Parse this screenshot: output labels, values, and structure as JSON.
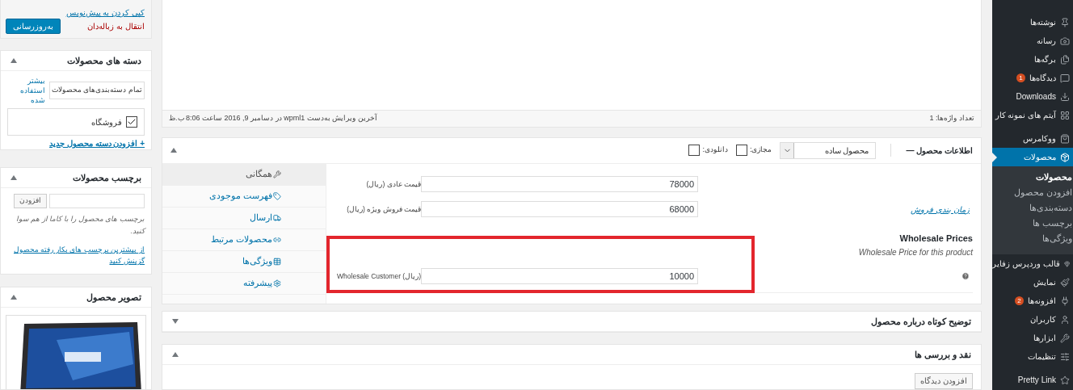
{
  "admin_menu": [
    {
      "label": "نوشته‌ها",
      "selected": false
    },
    {
      "label": "رسانه",
      "selected": false
    },
    {
      "label": "برگه‌ها",
      "selected": false
    },
    {
      "label": "دیدگاه‌ها",
      "badge": "1",
      "selected": false
    },
    {
      "label": "Downloads",
      "selected": false
    },
    {
      "label": "آیتم های نمونه کار",
      "selected": false
    },
    {
      "label": "ووکامرس",
      "selected": false
    },
    {
      "label": "محصولات",
      "selected": true,
      "children": [
        {
          "label": "محصولات",
          "selected": true
        },
        {
          "label": "افزودن محصول",
          "selected": false
        },
        {
          "label": "دسته‌بندی‌ها",
          "selected": false
        },
        {
          "label": "برچسب ها",
          "selected": false
        },
        {
          "label": "ویژگی‌ها",
          "selected": false
        }
      ]
    },
    {
      "label": "قالب وردپرس زفایر",
      "selected": false
    },
    {
      "label": "نمایش",
      "selected": false
    },
    {
      "label": "افزونه‌ها",
      "badge": "2",
      "selected": false
    },
    {
      "label": "کاربران",
      "selected": false
    },
    {
      "label": "ابزارها",
      "selected": false
    },
    {
      "label": "تنظیمات",
      "selected": false
    },
    {
      "label": "Pretty Link",
      "selected": false
    }
  ],
  "editor": {
    "word_count": "تعداد واژه‌ها: 1",
    "last_edit": "آخرین ویرایش به‌دست wpml1 در دسامبر 9, 2016 ساعت 8:06 ب.ظ"
  },
  "product_data": {
    "title": "اطلاعات محصول —",
    "expanded": true,
    "product_type": "محصول ساده",
    "options": [
      {
        "label": "مجازی:",
        "checked": false
      },
      {
        "label": "دانلودی:",
        "checked": false
      }
    ],
    "tabs": [
      {
        "label": "همگانی",
        "selected": true
      },
      {
        "label": "فهرست موجودی",
        "selected": false
      },
      {
        "label": "ارسال",
        "selected": false
      },
      {
        "label": "محصولات مرتبط",
        "selected": false
      },
      {
        "label": "ویژگی‌ها",
        "selected": false
      },
      {
        "label": "پیشرفته",
        "selected": false
      }
    ],
    "rows": [
      {
        "kind": "field",
        "label": "قیمت عادی (ریال)",
        "value": "78000",
        "help": false
      },
      {
        "kind": "field",
        "label": "قیمت فروش ویژه (ریال)",
        "value": "68000",
        "link": "زمان بندی فروش",
        "help": false
      },
      {
        "kind": "heading",
        "text": "Wholesale Prices"
      },
      {
        "kind": "description",
        "text": "Wholesale Price for this product"
      },
      {
        "kind": "field",
        "label": "(ریال) Wholesale Customer",
        "value": "10000",
        "help": true
      }
    ]
  },
  "short_description": {
    "title": "توضیح کوتاه درباره محصول",
    "expanded": false
  },
  "reviews": {
    "title": "نقد و بررسی ها",
    "expanded": true,
    "add_button": "افزودن دیدگاه"
  },
  "publish": {
    "draft_link": "کپی کردن به پیش‌نویس",
    "trash_link": "انتقال به زباله‌دان",
    "update_button": "به‌روزرسانی"
  },
  "categories": {
    "title": "دسته های محصولات",
    "expanded": true,
    "tabs": [
      {
        "label": "تمام دسته‌بندی‌های محصولات",
        "selected": true
      },
      {
        "label": "بیشتر استفاده شده",
        "selected": false
      }
    ],
    "items": [
      {
        "label": "فروشگاه",
        "checked": true
      }
    ],
    "add_link": "+ افزودن دسته محصول جدید"
  },
  "tags": {
    "title": "برچسب محصولات",
    "expanded": true,
    "add_button": "افزودن",
    "hint": "برچسب های محصول را با کاما از هم سوا کنید.",
    "choose_link": "از بیشترین برچسب های بکار رفته محصول گزینش کنید"
  },
  "product_image": {
    "title": "تصویر محصول",
    "expanded": true
  }
}
